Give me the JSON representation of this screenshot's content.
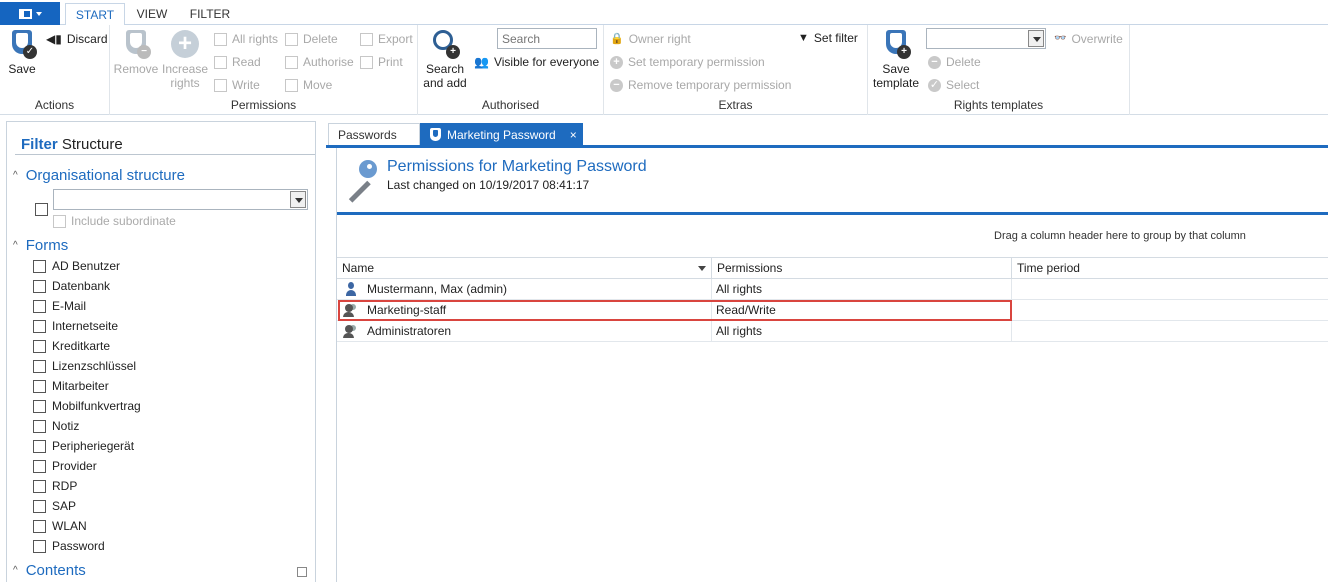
{
  "ribbon_tabs": [
    "START",
    "VIEW",
    "FILTER"
  ],
  "ribbon": {
    "actions": {
      "save": "Save",
      "discard": "Discard",
      "group": "Actions"
    },
    "permissions": {
      "remove": "Remove",
      "increase_1": "Increase",
      "increase_2": "rights",
      "all_rights": "All rights",
      "read": "Read",
      "write": "Write",
      "delete": "Delete",
      "authorise": "Authorise",
      "move": "Move",
      "export": "Export",
      "print": "Print",
      "group": "Permissions"
    },
    "authorised": {
      "search_1": "Search",
      "search_2": "and add",
      "search_placeholder": "Search",
      "visible": "Visible for everyone",
      "group": "Authorised"
    },
    "extras": {
      "owner": "Owner right",
      "set_temp": "Set temporary permission",
      "remove_temp": "Remove temporary permission",
      "set_filter": "Set filter",
      "group": "Extras"
    },
    "templates": {
      "save_1": "Save",
      "save_2": "template",
      "overwrite": "Overwrite",
      "delete": "Delete",
      "select": "Select",
      "group": "Rights templates"
    }
  },
  "left": {
    "filter": "Filter",
    "structure": "Structure",
    "org": "Organisational structure",
    "include_sub": "Include subordinate",
    "forms_title": "Forms",
    "forms": [
      "AD Benutzer",
      "Datenbank",
      "E-Mail",
      "Internetseite",
      "Kreditkarte",
      "Lizenzschlüssel",
      "Mitarbeiter",
      "Mobilfunkvertrag",
      "Notiz",
      "Peripheriegerät",
      "Provider",
      "RDP",
      "SAP",
      "WLAN",
      "Password"
    ],
    "contents": "Contents"
  },
  "doc_tabs": {
    "passwords": "Passwords",
    "marketing": "Marketing Password",
    "close": "×"
  },
  "main": {
    "title": "Permissions for Marketing Password",
    "last_changed": "Last changed on 10/19/2017 08:41:17",
    "group_hint": "Drag a column header here to group by that column",
    "columns": {
      "name": "Name",
      "permissions": "Permissions",
      "time": "Time period"
    },
    "rows": [
      {
        "name": "Mustermann, Max (admin)",
        "permissions": "All rights",
        "time": ""
      },
      {
        "name": "Marketing-staff",
        "permissions": "Read/Write",
        "time": ""
      },
      {
        "name": "Administratoren",
        "permissions": "All rights",
        "time": ""
      }
    ]
  }
}
